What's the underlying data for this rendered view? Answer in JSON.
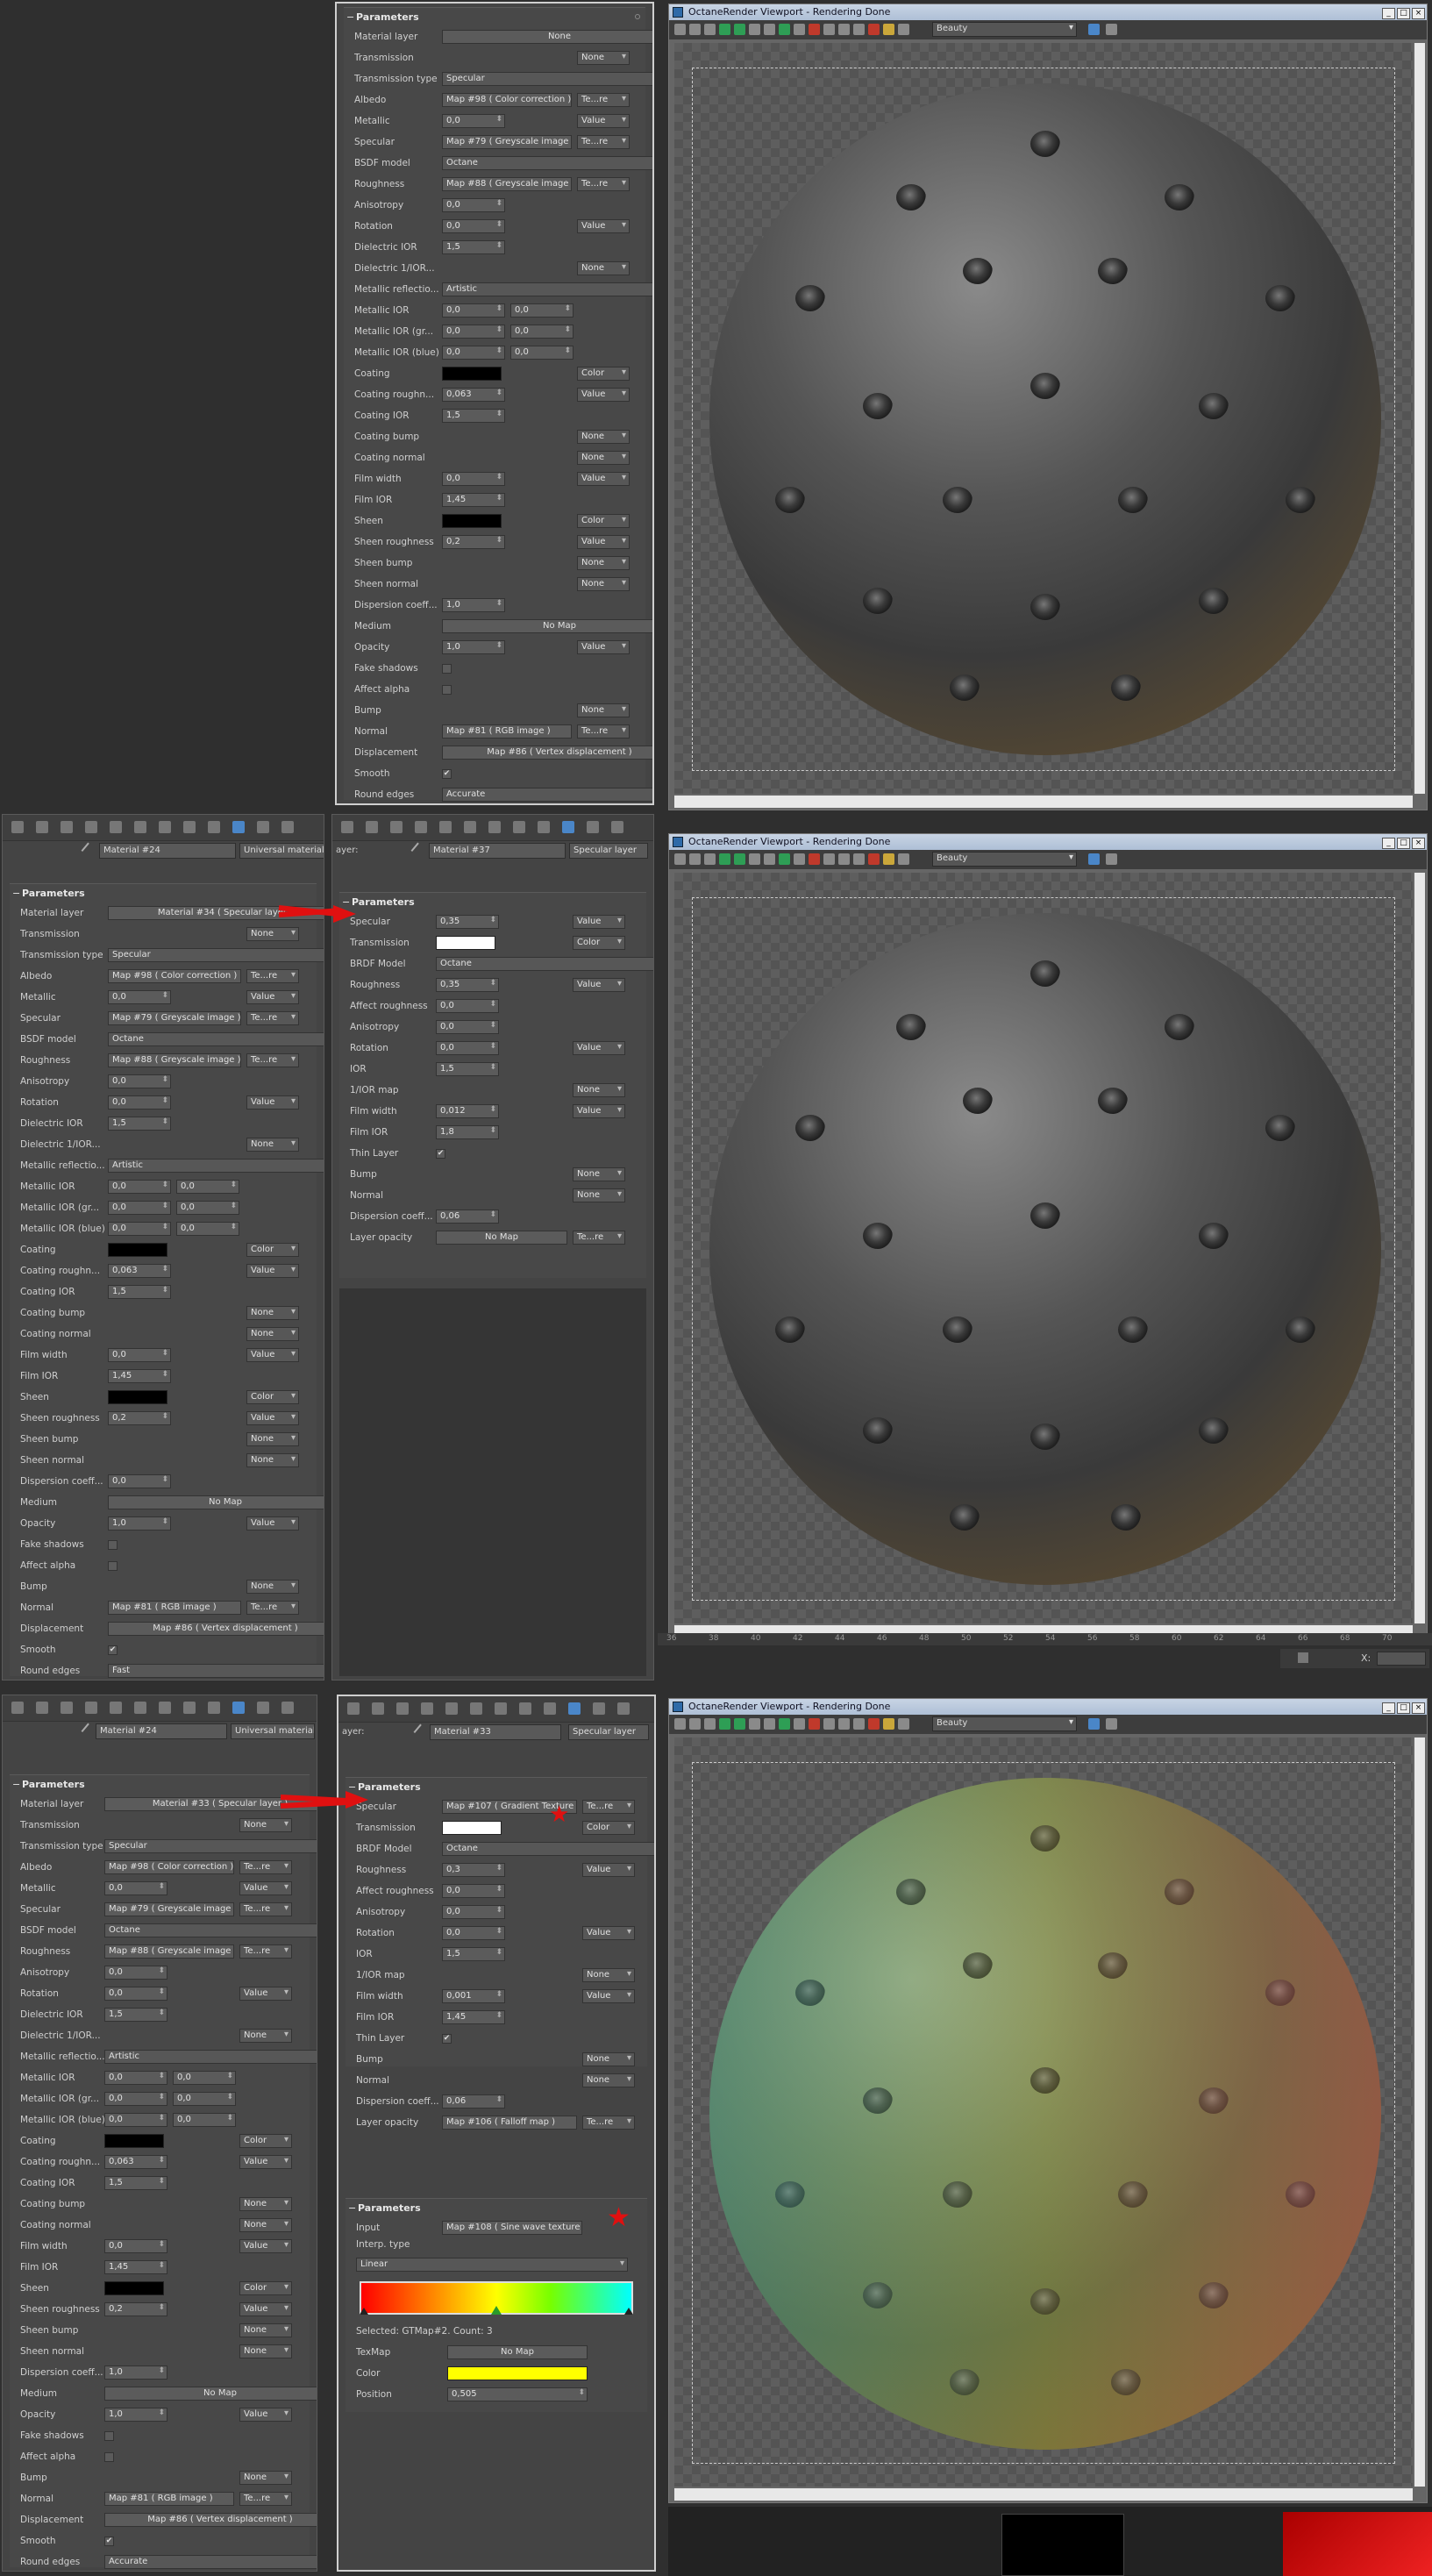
{
  "viewport": {
    "title": "OctaneRender Viewport - Rendering Done",
    "pass": "Beauty",
    "ruler_ticks": [
      "36",
      "38",
      "40",
      "42",
      "44",
      "46",
      "48",
      "50",
      "52",
      "54",
      "56",
      "58",
      "60",
      "62",
      "64",
      "66",
      "68",
      "70"
    ],
    "x_label": "X:"
  },
  "p1": {
    "rows": [
      {
        "label": "Material layer",
        "wide": "None"
      },
      {
        "label": "Transmission",
        "dd": "None"
      },
      {
        "label": "Transmission type",
        "ddwide": "Specular"
      },
      {
        "label": "Albedo",
        "map": "Map #98  ( Color correction )",
        "dd": "Te...re"
      },
      {
        "label": "Metallic",
        "spin": "0,0",
        "dd": "Value"
      },
      {
        "label": "Specular",
        "map": "Map #79  ( Greyscale image )",
        "dd": "Te...re"
      },
      {
        "label": "BSDF model",
        "ddwide": "Octane"
      },
      {
        "label": "Roughness",
        "map": "Map #88  ( Greyscale image )",
        "dd": "Te...re"
      },
      {
        "label": "Anisotropy",
        "spin": "0,0"
      },
      {
        "label": "Rotation",
        "spin": "0,0",
        "dd": "Value"
      },
      {
        "label": "Dielectric IOR",
        "spin": "1,5"
      },
      {
        "label": "Dielectric 1/IOR...",
        "dd": "None"
      },
      {
        "label": "Metallic reflectio...",
        "ddwide": "Artistic"
      },
      {
        "label": "Metallic IOR",
        "spin": "0,0",
        "spin2": "0,0"
      },
      {
        "label": "Metallic IOR (gr...",
        "spin": "0,0",
        "spin2": "0,0"
      },
      {
        "label": "Metallic IOR (blue)",
        "spin": "0,0",
        "spin2": "0,0"
      },
      {
        "label": "Coating",
        "swatch": "#000000",
        "dd": "Color"
      },
      {
        "label": "Coating roughn...",
        "spin": "0,063",
        "dd": "Value"
      },
      {
        "label": "Coating IOR",
        "spin": "1,5"
      },
      {
        "label": "Coating bump",
        "dd": "None"
      },
      {
        "label": "Coating normal",
        "dd": "None"
      },
      {
        "label": "Film width",
        "spin": "0,0",
        "dd": "Value"
      },
      {
        "label": "Film IOR",
        "spin": "1,45"
      },
      {
        "label": "Sheen",
        "swatch": "#000000",
        "dd": "Color"
      },
      {
        "label": "Sheen roughness",
        "spin": "0,2",
        "dd": "Value"
      },
      {
        "label": "Sheen bump",
        "dd": "None"
      },
      {
        "label": "Sheen normal",
        "dd": "None"
      },
      {
        "label": "Dispersion coeff...",
        "spin": "1,0"
      },
      {
        "label": "Medium",
        "wide": "No Map"
      },
      {
        "label": "Opacity",
        "spin": "1,0",
        "dd": "Value"
      },
      {
        "label": "Fake shadows",
        "check": ""
      },
      {
        "label": "Affect alpha",
        "check": ""
      },
      {
        "label": "Bump",
        "dd": "None"
      },
      {
        "label": "Normal",
        "map": "Map #81  ( RGB image )",
        "dd": "Te...re"
      },
      {
        "label": "Displacement",
        "wide": "Map #86  ( Vertex displacement )"
      },
      {
        "label": "Smooth",
        "check": "✔"
      },
      {
        "label": "Round edges",
        "ddwide": "Accurate"
      }
    ]
  },
  "p2": {
    "material": "Material #24",
    "type": "Universal material",
    "rows": [
      {
        "label": "Material layer",
        "wide": "Material #34  ( Specular layer )"
      },
      {
        "label": "Transmission",
        "dd": "None"
      },
      {
        "label": "Transmission type",
        "ddwide": "Specular"
      },
      {
        "label": "Albedo",
        "map": "Map #98  ( Color correction )",
        "dd": "Te...re"
      },
      {
        "label": "Metallic",
        "spin": "0,0",
        "dd": "Value"
      },
      {
        "label": "Specular",
        "map": "Map #79  ( Greyscale image )",
        "dd": "Te...re"
      },
      {
        "label": "BSDF model",
        "ddwide": "Octane"
      },
      {
        "label": "Roughness",
        "map": "Map #88  ( Greyscale image )",
        "dd": "Te...re"
      },
      {
        "label": "Anisotropy",
        "spin": "0,0"
      },
      {
        "label": "Rotation",
        "spin": "0,0",
        "dd": "Value"
      },
      {
        "label": "Dielectric IOR",
        "spin": "1,5"
      },
      {
        "label": "Dielectric 1/IOR...",
        "dd": "None"
      },
      {
        "label": "Metallic reflectio...",
        "ddwide": "Artistic"
      },
      {
        "label": "Metallic IOR",
        "spin": "0,0",
        "spin2": "0,0"
      },
      {
        "label": "Metallic IOR (gr...",
        "spin": "0,0",
        "spin2": "0,0"
      },
      {
        "label": "Metallic IOR (blue)",
        "spin": "0,0",
        "spin2": "0,0"
      },
      {
        "label": "Coating",
        "swatch": "#000000",
        "dd": "Color"
      },
      {
        "label": "Coating roughn...",
        "spin": "0,063",
        "dd": "Value"
      },
      {
        "label": "Coating IOR",
        "spin": "1,5"
      },
      {
        "label": "Coating bump",
        "dd": "None"
      },
      {
        "label": "Coating normal",
        "dd": "None"
      },
      {
        "label": "Film width",
        "spin": "0,0",
        "dd": "Value"
      },
      {
        "label": "Film IOR",
        "spin": "1,45"
      },
      {
        "label": "Sheen",
        "swatch": "#000000",
        "dd": "Color"
      },
      {
        "label": "Sheen roughness",
        "spin": "0,2",
        "dd": "Value"
      },
      {
        "label": "Sheen bump",
        "dd": "None"
      },
      {
        "label": "Sheen normal",
        "dd": "None"
      },
      {
        "label": "Dispersion coeff...",
        "spin": "0,0"
      },
      {
        "label": "Medium",
        "wide": "No Map"
      },
      {
        "label": "Opacity",
        "spin": "1,0",
        "dd": "Value"
      },
      {
        "label": "Fake shadows",
        "check": ""
      },
      {
        "label": "Affect alpha",
        "check": ""
      },
      {
        "label": "Bump",
        "dd": "None"
      },
      {
        "label": "Normal",
        "map": "Map #81  ( RGB image )",
        "dd": "Te...re"
      },
      {
        "label": "Displacement",
        "wide": "Map #86  ( Vertex displacement )"
      },
      {
        "label": "Smooth",
        "check": "✔"
      },
      {
        "label": "Round edges",
        "ddwide": "Fast"
      }
    ]
  },
  "p3": {
    "layer_label": "ayer:",
    "material": "Material #37",
    "type": "Specular layer",
    "rows": [
      {
        "label": "Specular",
        "spin": "0,35",
        "dd": "Value"
      },
      {
        "label": "Transmission",
        "swatch": "#ffffff",
        "dd": "Color"
      },
      {
        "label": "BRDF Model",
        "ddwide": "Octane"
      },
      {
        "label": "Roughness",
        "spin": "0,35",
        "dd": "Value"
      },
      {
        "label": "Affect roughness",
        "spin": "0,0"
      },
      {
        "label": "Anisotropy",
        "spin": "0,0"
      },
      {
        "label": "Rotation",
        "spin": "0,0",
        "dd": "Value"
      },
      {
        "label": "IOR",
        "spin": "1,5"
      },
      {
        "label": "1/IOR map",
        "dd": "None"
      },
      {
        "label": "Film width",
        "spin": "0,012",
        "dd": "Value"
      },
      {
        "label": "Film IOR",
        "spin": "1,8"
      },
      {
        "label": "Thin Layer",
        "check": "✔"
      },
      {
        "label": "Bump",
        "dd": "None"
      },
      {
        "label": "Normal",
        "dd": "None"
      },
      {
        "label": "Dispersion coeff...",
        "spin": "0,06"
      },
      {
        "label": "Layer opacity",
        "wide": "No Map",
        "dd": "Te...re"
      }
    ]
  },
  "p4": {
    "material": "Material #24",
    "type": "Universal material",
    "rows": [
      {
        "label": "Material layer",
        "wide": "Material #33  ( Specular layer )"
      },
      {
        "label": "Transmission",
        "dd": "None"
      },
      {
        "label": "Transmission type",
        "ddwide": "Specular"
      },
      {
        "label": "Albedo",
        "map": "Map #98  ( Color correction )",
        "dd": "Te...re"
      },
      {
        "label": "Metallic",
        "spin": "0,0",
        "dd": "Value"
      },
      {
        "label": "Specular",
        "map": "Map #79  ( Greyscale image )",
        "dd": "Te...re"
      },
      {
        "label": "BSDF model",
        "ddwide": "Octane"
      },
      {
        "label": "Roughness",
        "map": "Map #88  ( Greyscale image )",
        "dd": "Te...re"
      },
      {
        "label": "Anisotropy",
        "spin": "0,0"
      },
      {
        "label": "Rotation",
        "spin": "0,0",
        "dd": "Value"
      },
      {
        "label": "Dielectric IOR",
        "spin": "1,5"
      },
      {
        "label": "Dielectric 1/IOR...",
        "dd": "None"
      },
      {
        "label": "Metallic reflectio...",
        "ddwide": "Artistic"
      },
      {
        "label": "Metallic IOR",
        "spin": "0,0",
        "spin2": "0,0"
      },
      {
        "label": "Metallic IOR (gr...",
        "spin": "0,0",
        "spin2": "0,0"
      },
      {
        "label": "Metallic IOR (blue)",
        "spin": "0,0",
        "spin2": "0,0"
      },
      {
        "label": "Coating",
        "swatch": "#000000",
        "dd": "Color"
      },
      {
        "label": "Coating roughn...",
        "spin": "0,063",
        "dd": "Value"
      },
      {
        "label": "Coating IOR",
        "spin": "1,5"
      },
      {
        "label": "Coating bump",
        "dd": "None"
      },
      {
        "label": "Coating normal",
        "dd": "None"
      },
      {
        "label": "Film width",
        "spin": "0,0",
        "dd": "Value"
      },
      {
        "label": "Film IOR",
        "spin": "1,45"
      },
      {
        "label": "Sheen",
        "swatch": "#000000",
        "dd": "Color"
      },
      {
        "label": "Sheen roughness",
        "spin": "0,2",
        "dd": "Value"
      },
      {
        "label": "Sheen bump",
        "dd": "None"
      },
      {
        "label": "Sheen normal",
        "dd": "None"
      },
      {
        "label": "Dispersion coeff...",
        "spin": "1,0"
      },
      {
        "label": "Medium",
        "wide": "No Map"
      },
      {
        "label": "Opacity",
        "spin": "1,0",
        "dd": "Value"
      },
      {
        "label": "Fake shadows",
        "check": ""
      },
      {
        "label": "Affect alpha",
        "check": ""
      },
      {
        "label": "Bump",
        "dd": "None"
      },
      {
        "label": "Normal",
        "map": "Map #81  ( RGB image )",
        "dd": "Te...re"
      },
      {
        "label": "Displacement",
        "wide": "Map #86  ( Vertex displacement )"
      },
      {
        "label": "Smooth",
        "check": "✔"
      },
      {
        "label": "Round edges",
        "ddwide": "Accurate"
      }
    ]
  },
  "p5": {
    "layer_label": "ayer:",
    "material": "Material #33",
    "type": "Specular layer",
    "rows": [
      {
        "label": "Specular",
        "map": "Map #107  ( Gradient Texture )",
        "dd": "Te...re"
      },
      {
        "label": "Transmission",
        "swatch": "#ffffff",
        "dd": "Color"
      },
      {
        "label": "BRDF Model",
        "ddwide": "Octane"
      },
      {
        "label": "Roughness",
        "spin": "0,3",
        "dd": "Value"
      },
      {
        "label": "Affect roughness",
        "spin": "0,0"
      },
      {
        "label": "Anisotropy",
        "spin": "0,0"
      },
      {
        "label": "Rotation",
        "spin": "0,0",
        "dd": "Value"
      },
      {
        "label": "IOR",
        "spin": "1,5"
      },
      {
        "label": "1/IOR map",
        "dd": "None"
      },
      {
        "label": "Film width",
        "spin": "0,001",
        "dd": "Value"
      },
      {
        "label": "Film IOR",
        "spin": "1,45"
      },
      {
        "label": "Thin Layer",
        "check": "✔"
      },
      {
        "label": "Bump",
        "dd": "None"
      },
      {
        "label": "Normal",
        "dd": "None"
      },
      {
        "label": "Dispersion coeff...",
        "spin": "0,06"
      },
      {
        "label": "Layer opacity",
        "map": "Map #106  ( Falloff map )",
        "dd": "Te...re"
      }
    ],
    "grad": {
      "input_label": "Input",
      "input_value": "Map #108  ( Sine wave texture )",
      "interp_label": "Interp. type",
      "interp_value": "Linear",
      "selected": "Selected: GTMap#2.  Count: 3",
      "texmap_label": "TexMap",
      "texmap_value": "No Map",
      "color_label": "Color",
      "color_value": "#ffff00",
      "position_label": "Position",
      "position_value": "0,505"
    }
  },
  "rollout_title": "Parameters",
  "colors": {
    "accent": "#4a86c8",
    "annotation": "#e01010"
  }
}
